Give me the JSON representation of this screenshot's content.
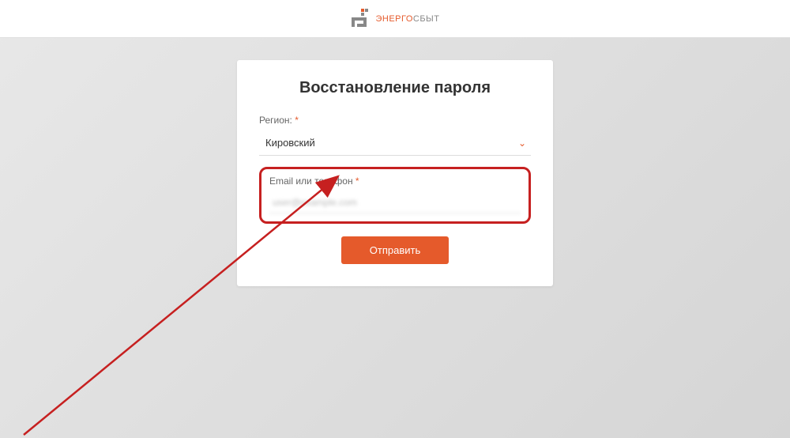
{
  "header": {
    "brand_line1": "ЭНЕРГО",
    "brand_line2": "СБЫТ"
  },
  "card": {
    "title": "Восстановление пароля",
    "region_label": "Регион:",
    "region_value": "Кировский",
    "email_label": "Email или телефон",
    "email_value": "user@example.com",
    "submit_label": "Отправить",
    "required_mark": "*"
  }
}
